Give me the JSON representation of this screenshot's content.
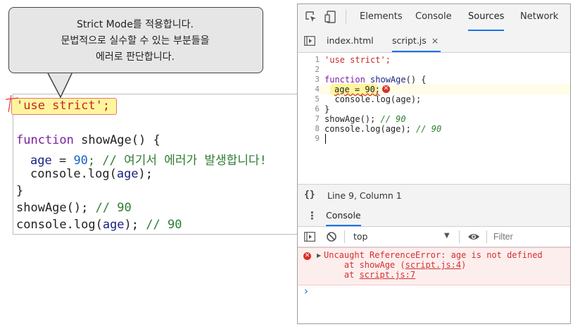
{
  "callout": {
    "line1": "Strict Mode를 적용합니다.",
    "line2": "문법적으로 실수할 수 있는 부분들을",
    "line3": "에러로 판단합니다."
  },
  "code": {
    "strict": "'use strict';",
    "line_func_kw": "function",
    "line_func_rest": " showAge() {",
    "line_age_var": "age",
    "line_age_eq": " = ",
    "line_age_num": "90",
    "line_age_comment": "; // 여기서 에러가 발생합니다!",
    "line_log_pre": "console.log(",
    "line_log_var": "age",
    "line_log_post": ");",
    "line_close": "}",
    "line_call": "showAge(); ",
    "line_call_comment": "// 90",
    "line_log2_pre": "console.log(",
    "line_log2_var": "age",
    "line_log2_post": "); ",
    "line_log2_comment": "// 90"
  },
  "devtools": {
    "tabs": [
      "Elements",
      "Console",
      "Sources",
      "Network"
    ],
    "active_tab": "Sources",
    "files": [
      "index.html",
      "script.js"
    ],
    "active_file": "script.js",
    "file_close": "×",
    "line_numbers": [
      "1",
      "2",
      "3",
      "4",
      "5",
      "6",
      "7",
      "8",
      "9"
    ],
    "editor_lines": {
      "l1": "'use strict';",
      "l3_kw": "function",
      "l3_name": " showAge",
      "l3_rest": "() {",
      "l4": "age = 90;",
      "l5": "  console.log(age);",
      "l6": "}",
      "l7_code": "showAge(); ",
      "l7_cmt": "// 90",
      "l8_code": "console.log(age); ",
      "l8_cmt": "// 90"
    },
    "status": "Line 9, Column 1",
    "status_icon": "{}",
    "drawer_title": "Console",
    "context": "top",
    "filter_placeholder": "Filter",
    "error": {
      "message": "Uncaught ReferenceError: age is not defined",
      "at1_prefix": "    at showAge (",
      "at1_link": "script.js:4",
      "at1_suffix": ")",
      "at2_prefix": "    at ",
      "at2_link": "script.js:7"
    },
    "prompt": "›"
  },
  "colors": {
    "accent": "#1a73e8",
    "error": "#d93025",
    "highlight": "#fff59d"
  }
}
